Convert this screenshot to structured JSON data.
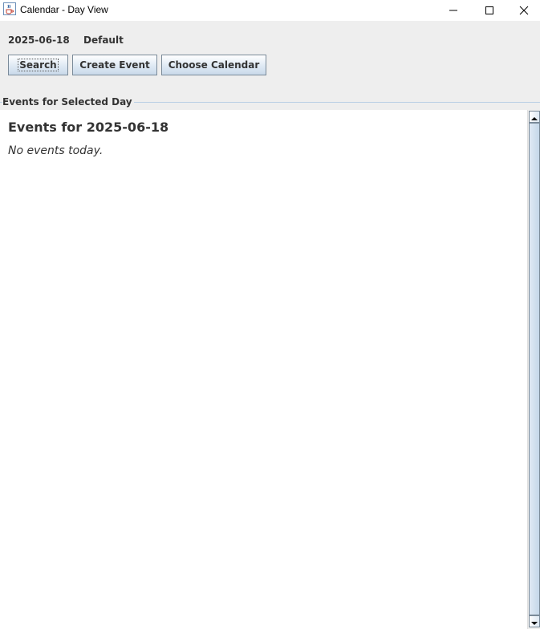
{
  "window": {
    "title": "Calendar - Day View"
  },
  "header": {
    "date": "2025-06-18",
    "calendar_name": "Default"
  },
  "toolbar": {
    "search_label": "Search",
    "create_label": "Create Event",
    "choose_label": "Choose Calendar"
  },
  "section": {
    "title": "Events for Selected Day"
  },
  "events": {
    "heading": "Events for 2025-06-18",
    "empty_message": "No events today.",
    "items": []
  },
  "icons": {
    "app": "java-cup-icon",
    "minimize": "minimize-icon",
    "maximize": "maximize-icon",
    "close": "close-icon"
  },
  "colors": {
    "accent_border": "#7a8a99",
    "button_gradient_bottom": "#c9d9ea",
    "section_line": "#b8cfe5"
  }
}
